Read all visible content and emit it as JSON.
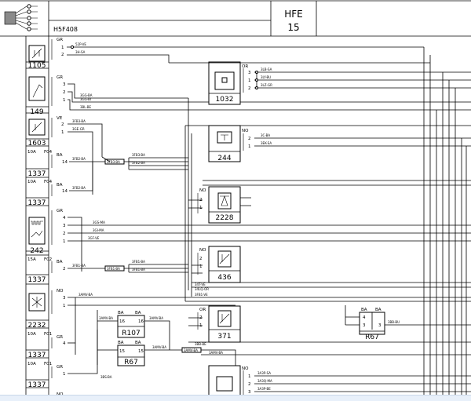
{
  "header": {
    "code": "H5F408",
    "sheet_title": "HFE",
    "sheet_number": "15"
  },
  "left_components": [
    {
      "id": "1105",
      "colour": "GR",
      "pins": [
        "1",
        "2"
      ],
      "wires": [
        "52P-VE",
        "3H-SA"
      ]
    },
    {
      "id": "149",
      "colour": "GR",
      "pins": [
        "3",
        "2",
        "1"
      ],
      "wires": [
        "3GG-BA",
        "3GG-BI",
        "3BL-BE"
      ]
    },
    {
      "id": "1603",
      "colour": "VE",
      "pins": [
        "2",
        "1"
      ],
      "wires": [
        "3FB3-BA",
        "3GE-GR"
      ]
    },
    {
      "id": "1337",
      "fuse": "10A",
      "fuse_ref": "F04",
      "colour": "BA",
      "pins": [
        "14"
      ],
      "wires": [
        "3FB2-BA"
      ]
    },
    {
      "id": "1337",
      "fuse": "10A",
      "fuse_ref": "F04",
      "colour": "BA",
      "pins": [
        "14"
      ],
      "wires": [
        "3FB2-BA"
      ]
    },
    {
      "id": "242",
      "colour": "GR",
      "pins": [
        "4",
        "3",
        "2",
        "1"
      ],
      "wires": [
        "3GS-MA",
        "3GI-MA",
        "3GF-VE"
      ]
    },
    {
      "id": "1337",
      "fuse": "15A",
      "fuse_ref": "F02",
      "colour": "BA",
      "pins": [
        "2"
      ],
      "wires": [
        "3FB1-BA"
      ]
    },
    {
      "id": "2232",
      "colour": "NO",
      "pins": [
        "3",
        "1"
      ],
      "wires": [
        "3AMV-BA"
      ]
    },
    {
      "id": "1337",
      "fuse": "10A",
      "fuse_ref": "F01",
      "colour": "GR",
      "pins": [
        "4"
      ],
      "wires": []
    },
    {
      "id": "1337",
      "fuse": "10A",
      "fuse_ref": "F01",
      "colour": "GR",
      "pins": [
        "1"
      ],
      "wires": [
        "3BS-BA"
      ]
    }
  ],
  "bottom_stub": {
    "colour": "NO"
  },
  "splices": [
    "3FB3-BA",
    "3FB1-BA",
    "3AMV-BA"
  ],
  "trunk_labels": [
    "3FB3-BA",
    "3FB2-BA",
    "3FB1-BA",
    "3FB1-VE",
    "3AMV-BA",
    "3FB3-VE"
  ],
  "right_components": [
    {
      "id": "1032",
      "colour": "OR",
      "pins": [
        "3",
        "1",
        "2"
      ],
      "wires": [
        "3LB-SA",
        "3LY-BU",
        "3LZ-GR"
      ]
    },
    {
      "id": "244",
      "colour": "NO",
      "pins": [
        "2",
        "1"
      ],
      "wires": [
        "3C-BA",
        "3EK-SA"
      ]
    },
    {
      "id": "2228",
      "colour": "NO",
      "pins": [
        "2",
        "1"
      ],
      "wires": []
    },
    {
      "id": "436",
      "colour": "NO",
      "pins": [
        "2",
        "1"
      ],
      "wires": [
        "34T-VE",
        "34LQ-OR"
      ]
    },
    {
      "id": "371",
      "colour": "OR",
      "pins": [
        "2",
        "1"
      ],
      "wires": [
        "3FB1-VE",
        "3BB-BE"
      ]
    },
    {
      "id": "NO-block",
      "colour": "NO",
      "pins": [
        "1",
        "2",
        "3"
      ],
      "wires": [
        "3A3P-SA",
        "3A3Q-MA",
        "3A3P-BE"
      ]
    }
  ],
  "relays": [
    {
      "id": "R107",
      "colour_left": "BA",
      "colour_right": "BA",
      "pins": [
        "16",
        "16"
      ],
      "wire": "3AMV-BA"
    },
    {
      "id": "R67",
      "colour_left": "BA",
      "colour_right": "BA",
      "pins": [
        "15",
        "15"
      ],
      "wire": "3AMV-BA"
    },
    {
      "id": "R67",
      "colour_left": "BA",
      "colour_right": "BA",
      "pins": [
        "4",
        "3",
        "3"
      ],
      "wire": "3BB-BU"
    }
  ]
}
